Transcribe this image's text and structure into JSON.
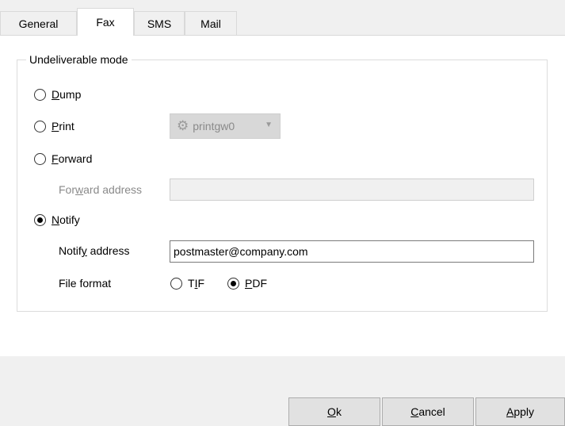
{
  "tabs": [
    "General",
    "Fax",
    "SMS",
    "Mail"
  ],
  "active_tab": "Fax",
  "group": {
    "title": "Undeliverable mode"
  },
  "modes": {
    "dump": {
      "accel": "D",
      "rest": "ump",
      "checked": false
    },
    "print": {
      "accel": "P",
      "rest": "rint",
      "checked": false
    },
    "forward": {
      "accel": "F",
      "rest": "orward",
      "checked": false
    },
    "notify": {
      "accel": "N",
      "rest": "otify",
      "checked": true
    }
  },
  "printer": {
    "value": "printgw0",
    "icon": "gear-icon",
    "enabled": false
  },
  "forward_address": {
    "pre": "For",
    "accel": "w",
    "post": "ard address",
    "value": "",
    "enabled": false
  },
  "notify_address": {
    "pre": "Notif",
    "accel": "y",
    "post": " address",
    "value": "postmaster@company.com"
  },
  "file_format": {
    "label": "File format",
    "tif": {
      "pre": "T",
      "accel": "I",
      "post": "F",
      "checked": false
    },
    "pdf": {
      "accel": "P",
      "post": "DF",
      "checked": true
    }
  },
  "buttons": {
    "ok": {
      "accel": "O",
      "rest": "k"
    },
    "cancel": {
      "accel": "C",
      "rest": "ancel"
    },
    "apply": {
      "accel": "A",
      "rest": "pply"
    }
  }
}
